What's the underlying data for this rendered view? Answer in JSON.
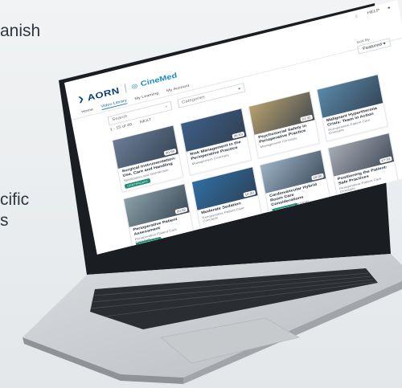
{
  "side_text": [
    "anish",
    "cific",
    "s"
  ],
  "app": {
    "top_actions": [
      "HELP"
    ],
    "logo_aorn": "AORN",
    "logo_cinemed": "CineMed",
    "tabs": [
      "Home",
      "Video Library",
      "My Learning",
      "My Account"
    ],
    "active_tab": "Video Library",
    "sort_label": "Sort By",
    "sort_value": "Featured",
    "search_placeholder": "Search",
    "category_placeholder": "Categories",
    "results": [
      "1 - 15 of 49",
      "NEXT"
    ]
  },
  "cards": [
    {
      "title": "Surgical Instrumentation: Use, Care and Handling",
      "category": "Sterilization and Disinfection",
      "duration": "20:59",
      "cert": "CERTIFICATE",
      "color": "#6a7d96"
    },
    {
      "title": "Risk Management in the Perioperative Practice",
      "category": "Management Concepts",
      "duration": "25:53",
      "cert": "",
      "color": "#3d5e86"
    },
    {
      "title": "Psychosocial Safety in Perioperative Practice",
      "category": "Management Concepts",
      "duration": "21:32",
      "cert": "",
      "color": "#b7a06e"
    },
    {
      "title": "Malignant Hyperthermia Crisis: Team in Action",
      "category": "Perioperative Patient Care Concepts",
      "duration": "",
      "cert": "",
      "color": "#5a88a8"
    },
    {
      "title": "Perioperative Patient Assessment",
      "category": "Perioperative Patient Care Concepts",
      "duration": "20:32",
      "cert": "CERTIFICATE",
      "color": "#8aa0a8"
    },
    {
      "title": "Moderate Sedation",
      "category": "Perioperative Patient Care Concepts",
      "duration": "14:20",
      "cert": "",
      "color": "#2f6da3"
    },
    {
      "title": "Cardiovascular Hybrid Room Care Considerations",
      "category": "Management Concepts",
      "duration": "20:06",
      "cert": "CERTIFICATE",
      "color": "#9bb2c4"
    },
    {
      "title": "Positioning the Patient: Safe Practices",
      "category": "Perioperative Patient Care Concepts",
      "duration": "17:33",
      "cert": "",
      "color": "#a7abb3"
    }
  ]
}
